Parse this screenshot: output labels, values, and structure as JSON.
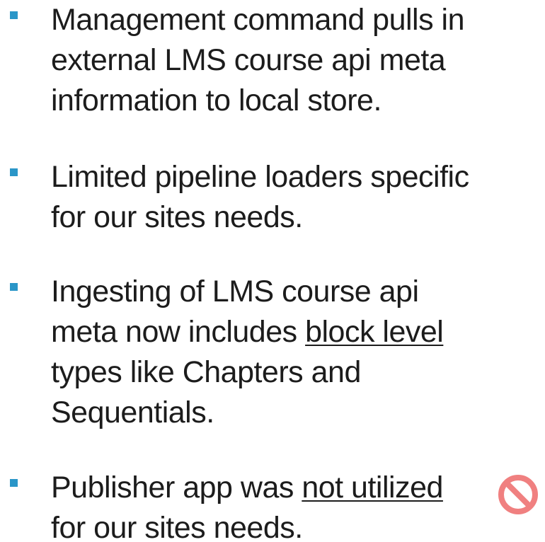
{
  "bullets": [
    {
      "lines": [
        "Management command pulls in",
        "external LMS course api meta",
        "information to local store."
      ]
    },
    {
      "lines": [
        "Limited pipeline loaders specific",
        "for our sites needs."
      ]
    },
    {
      "line1_pre": "Ingesting of LMS course api",
      "line2_pre": "meta now includes ",
      "line2_underlined": "block level",
      "line3": "types like Chapters and",
      "line4": "Sequentials."
    },
    {
      "line1_pre": "Publisher app was ",
      "line1_underlined": "not utilized",
      "line2": "for our sites needs."
    }
  ],
  "colors": {
    "bullet": "#2a96c8",
    "prohibited_icon": "#f08080",
    "text": "#1c1c1c"
  },
  "icons": {
    "prohibited": "prohibited-icon"
  }
}
